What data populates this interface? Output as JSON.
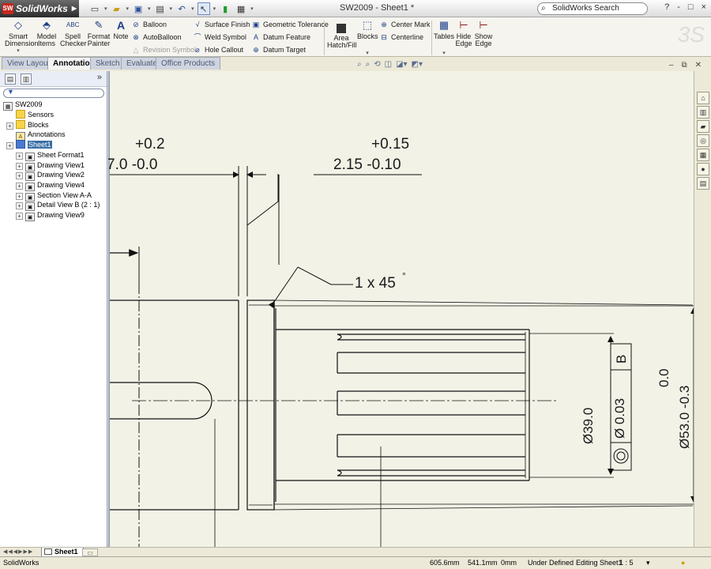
{
  "app": {
    "logo_label": "SolidWorks",
    "doc_title": "SW2009 - Sheet1 *"
  },
  "search": {
    "placeholder": "SolidWorks Search"
  },
  "window_buttons": [
    "?",
    "-",
    "□",
    "×"
  ],
  "command_manager": {
    "big_tools": [
      "Smart Dimension",
      "Model Items",
      "Spell Checker",
      "Format Painter",
      "Note"
    ],
    "annotation_col1": [
      "Balloon",
      "AutoBalloon",
      "Revision Symbol"
    ],
    "annotation_col2": [
      "Surface Finish",
      "Weld Symbol",
      "Hole Callout"
    ],
    "annotation_col3": [
      "Geometric Tolerance",
      "Datum Feature",
      "Datum Target"
    ],
    "area_hatch": "Area Hatch/Fill",
    "blocks": "Blocks",
    "center_col": [
      "Center Mark",
      "Centerline"
    ],
    "right_tools": [
      "Tables",
      "Hide Edge",
      "Show Edge"
    ]
  },
  "tabs": [
    "View Layout",
    "Annotation",
    "Sketch",
    "Evaluate",
    "Office Products"
  ],
  "active_tab": "Annotation",
  "tree": {
    "root": "SW2009",
    "items": [
      {
        "label": "Sensors",
        "level": 1,
        "expandable": false
      },
      {
        "label": "Blocks",
        "level": 1,
        "expandable": true
      },
      {
        "label": "Annotations",
        "level": 1,
        "expandable": false
      },
      {
        "label": "Sheet1",
        "level": 1,
        "expandable": true,
        "selected": true
      },
      {
        "label": "Sheet Format1",
        "level": 2,
        "expandable": true
      },
      {
        "label": "Drawing View1",
        "level": 2,
        "expandable": true
      },
      {
        "label": "Drawing View2",
        "level": 2,
        "expandable": true
      },
      {
        "label": "Drawing View4",
        "level": 2,
        "expandable": true
      },
      {
        "label": "Section View A-A",
        "level": 2,
        "expandable": true
      },
      {
        "label": "Detail View B (2 : 1)",
        "level": 2,
        "expandable": true
      },
      {
        "label": "Drawing View9",
        "level": 2,
        "expandable": true
      }
    ]
  },
  "drawing": {
    "dim_left_upper": "+0.2",
    "dim_left_lower": "7.0 -0.0",
    "dim_right_upper": "+0.15",
    "dim_right_lower": "2.15 -0.10",
    "chamfer_note": "1 x 45",
    "chamfer_degree": "°",
    "dia_39": "Ø39.0",
    "gtol_value": "Ø  0.03",
    "gtol_datum": "B",
    "dia_53_upper": "0.0",
    "dia_53_lower": "Ø53.0 -0.3"
  },
  "sheet_tabs": {
    "active": "Sheet1"
  },
  "status_bar": {
    "app": "SolidWorks",
    "x": "605.6mm",
    "y": "541.1mm",
    "z": "0mm",
    "state": "Under Defined",
    "editing": "Editing Sheet1",
    "scale": "1 : 5"
  }
}
